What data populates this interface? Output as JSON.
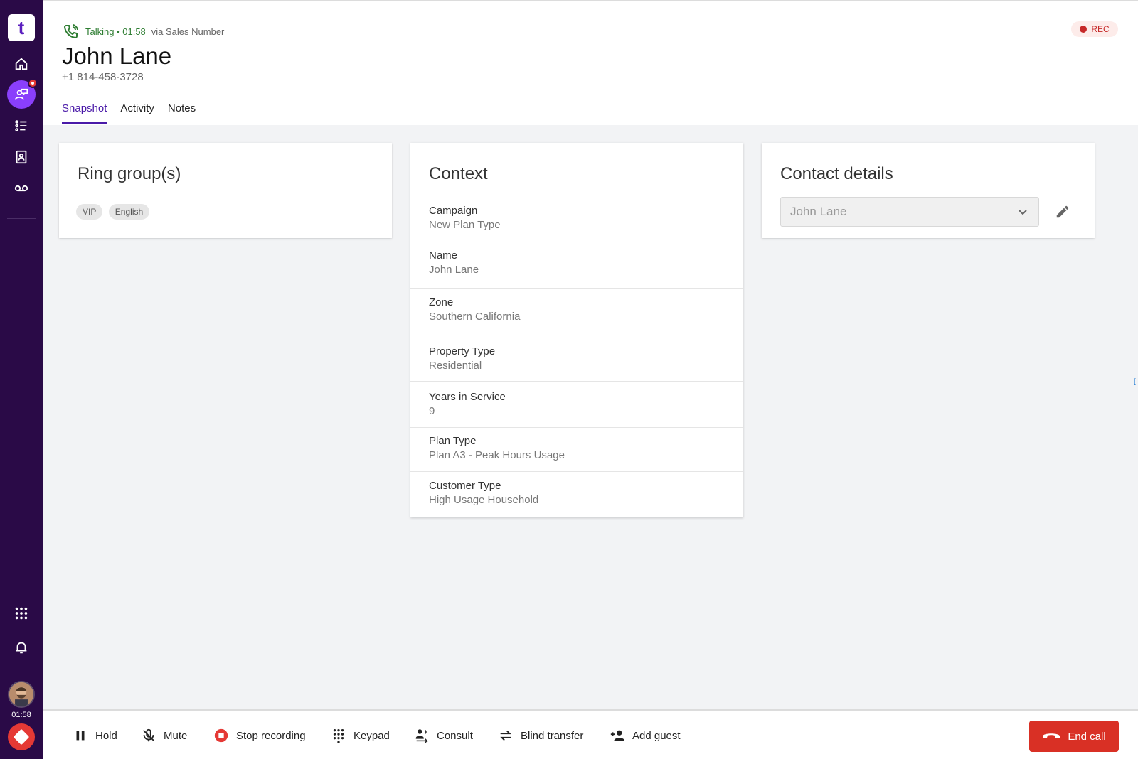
{
  "app": {
    "brand": "t",
    "accent_color": "#4a1aa8",
    "sidebar_color": "#2a0a47"
  },
  "sidebar": {
    "items": [
      {
        "icon": "home-icon"
      },
      {
        "icon": "chat-person-icon",
        "badge": true
      },
      {
        "icon": "list-icon"
      },
      {
        "icon": "contacts-icon"
      },
      {
        "icon": "voicemail-icon"
      }
    ],
    "bottom": {
      "apps_icon": "apps-grid-icon",
      "notifications_icon": "bell-icon",
      "timer": "01:58"
    }
  },
  "header": {
    "status": "Talking • 01:58",
    "via": "via Sales Number",
    "name": "John Lane",
    "phone": "+1 814-458-3728",
    "rec_label": "REC",
    "tabs": [
      {
        "label": "Snapshot",
        "active": true
      },
      {
        "label": "Activity",
        "active": false
      },
      {
        "label": "Notes",
        "active": false
      }
    ]
  },
  "ring_group": {
    "title": "Ring group(s)",
    "chips": [
      "VIP",
      "English"
    ]
  },
  "context": {
    "title": "Context",
    "rows": [
      {
        "label": "Campaign",
        "value": "New Plan Type"
      },
      {
        "label": "Name",
        "value": "John Lane"
      },
      {
        "label": "Zone",
        "value": "Southern California"
      },
      {
        "label": "Property Type",
        "value": "Residential"
      },
      {
        "label": "Years in Service",
        "value": "9"
      },
      {
        "label": "Plan Type",
        "value": "Plan A3 - Peak Hours Usage"
      },
      {
        "label": "Customer Type",
        "value": "High Usage Household"
      }
    ]
  },
  "contact_details": {
    "title": "Contact details",
    "selected_contact": "John Lane"
  },
  "toolbar": {
    "hold": "Hold",
    "mute": "Mute",
    "stop_recording": "Stop recording",
    "keypad": "Keypad",
    "consult": "Consult",
    "blind_transfer": "Blind transfer",
    "add_guest": "Add guest",
    "end_call": "End call"
  },
  "edge_marker": "["
}
